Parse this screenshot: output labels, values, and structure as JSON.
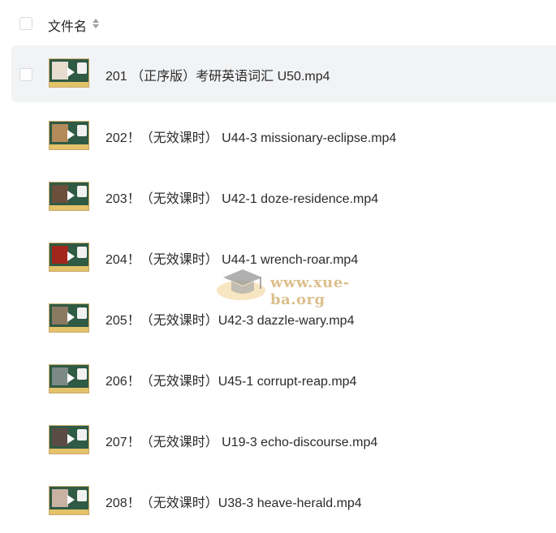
{
  "header": {
    "select_all": false,
    "column_label": "文件名",
    "sort_icon": "sort-icon"
  },
  "files": [
    {
      "name": "201 （正序版）考研英语词汇 U50.mp4",
      "selected": true,
      "thumb_pic": "#e8dccf"
    },
    {
      "name": "202！（无效课时） U44-3 missionary-eclipse.mp4",
      "selected": false,
      "thumb_pic": "#b58a5a"
    },
    {
      "name": "203！（无效课时） U42-1 doze-residence.mp4",
      "selected": false,
      "thumb_pic": "#6b4f3a"
    },
    {
      "name": "204！（无效课时） U44-1 wrench-roar.mp4",
      "selected": false,
      "thumb_pic": "#a3261c"
    },
    {
      "name": "205！（无效课时）U42-3 dazzle-wary.mp4",
      "selected": false,
      "thumb_pic": "#8a7a62"
    },
    {
      "name": "206！（无效课时）U45-1 corrupt-reap.mp4",
      "selected": false,
      "thumb_pic": "#7c8a86"
    },
    {
      "name": "207！（无效课时） U19-3 echo-discourse.mp4",
      "selected": false,
      "thumb_pic": "#5a4b45"
    },
    {
      "name": "208！（无效课时）U38-3 heave-herald.mp4",
      "selected": false,
      "thumb_pic": "#c9b2a2"
    }
  ],
  "watermark": {
    "text": "www.xue-ba.org"
  },
  "colors": {
    "selected_row_bg": "#f2f3f5",
    "thumb_bg": "#2f5a44",
    "thumb_bar": "#e4c26a"
  }
}
